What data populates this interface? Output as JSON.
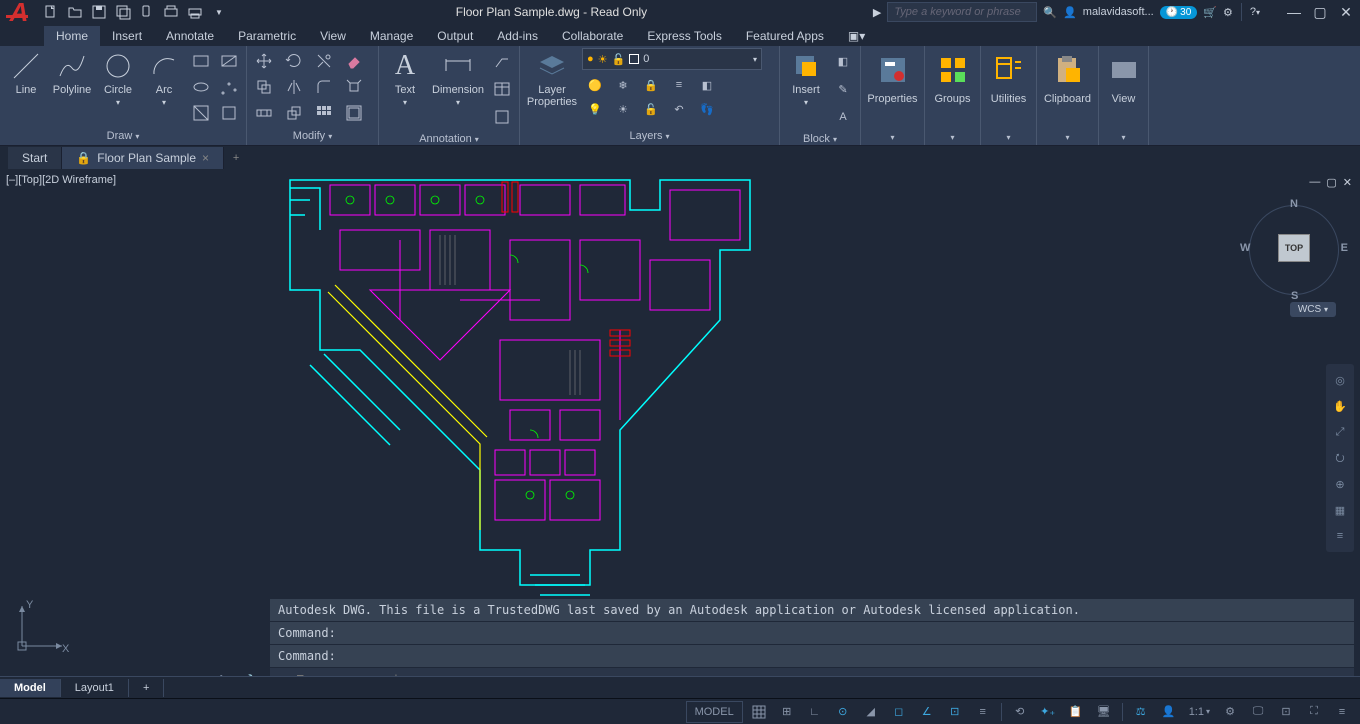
{
  "title": "Floor Plan Sample.dwg - Read Only",
  "search_placeholder": "Type a keyword or phrase",
  "user": "malavidasoft...",
  "trial_days": "30",
  "menus": [
    "Home",
    "Insert",
    "Annotate",
    "Parametric",
    "View",
    "Manage",
    "Output",
    "Add-ins",
    "Collaborate",
    "Express Tools",
    "Featured Apps"
  ],
  "active_menu": "Home",
  "panels": {
    "draw": {
      "title": "Draw",
      "tools": [
        "Line",
        "Polyline",
        "Circle",
        "Arc"
      ]
    },
    "modify": {
      "title": "Modify"
    },
    "annotation": {
      "title": "Annotation",
      "tools": [
        "Text",
        "Dimension"
      ]
    },
    "layers": {
      "title": "Layers",
      "props": "Layer Properties",
      "current": "0"
    },
    "block": {
      "title": "Block",
      "insert": "Insert"
    },
    "properties": {
      "title": "Properties"
    },
    "groups": {
      "title": "Groups"
    },
    "utilities": {
      "title": "Utilities"
    },
    "clipboard": {
      "title": "Clipboard"
    },
    "view": {
      "title": "View"
    }
  },
  "filetabs": {
    "start": "Start",
    "current": "Floor Plan Sample"
  },
  "viewport_label": "[–][Top][2D Wireframe]",
  "viewcube": {
    "top": "TOP",
    "n": "N",
    "s": "S",
    "e": "E",
    "w": "W",
    "wcs": "WCS"
  },
  "cmd_history_1": "Autodesk DWG.  This file is a TrustedDWG last saved by an Autodesk application or Autodesk licensed application.",
  "cmd_history_2": "Command:",
  "cmd_history_3": "Command:",
  "cmd_placeholder": "Type a command",
  "bottom_tabs": [
    "Model",
    "Layout1"
  ],
  "status": {
    "model": "MODEL",
    "scale": "1:1",
    "ucs_y": "Y",
    "ucs_x": "X"
  }
}
